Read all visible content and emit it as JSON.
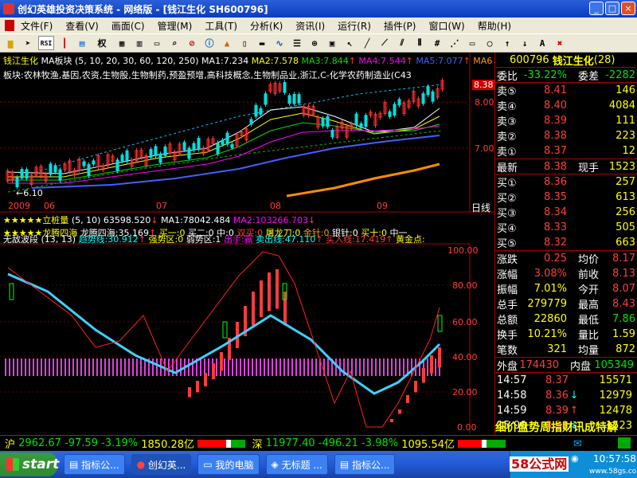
{
  "window": {
    "title": "创幻英雄投资决策系统 - 网络版 - [钱江生化 SH600796]"
  },
  "menu": [
    "文件(F)",
    "查看(V)",
    "画面(C)",
    "管理(M)",
    "工具(T)",
    "分析(K)",
    "资讯(I)",
    "运行(R)",
    "插件(P)",
    "窗口(W)",
    "帮助(H)"
  ],
  "toolbar": {
    "rsi": "RSI",
    "fn": "权"
  },
  "chart": {
    "main_header": {
      "name": "钱江生化",
      "ma_label": "MA板块",
      "ma_params": "(5, 10, 20, 30, 60, 120, 250)",
      "ma1": "MA1:7.234",
      "ma2": "MA2:7.578",
      "ma3": "MA3:7.844",
      "ma4": "MA4:7.544",
      "ma5": "MA5:7.077",
      "ma6": "MA6"
    },
    "sector_line": "板块:农林牧渔,基因,农资,生物股,生物制药,预盈预增,高科技概念,生物制品业,浙江,C-化学农药制造业(C43",
    "price_labels": [
      "8.38",
      "8.00",
      "7.00"
    ],
    "low_label": "6.10",
    "date_labels": [
      "2009",
      "06",
      "07",
      "08",
      "09"
    ],
    "period": "日线",
    "vol_header": {
      "stars": "★★★★★",
      "name": "立桩量",
      "params": "(5, 10)",
      "value": "63598.520",
      "ma1": "MA1:78042.484",
      "ma2": "MA2:103266.703"
    },
    "ind1": {
      "stars": "★★★★★",
      "name": "龙腾四海",
      "v1": "龙腾四海:35.169",
      "v2": "买一:0",
      "v3": "买二:0",
      "v4": "中:0",
      "v5": "双买:0",
      "v6": "屠龙刀:0",
      "v7": "金针:0",
      "v8": "银针:0",
      "v9": "买十:0",
      "v10": "中一"
    },
    "ind2": {
      "name": "无敌波段",
      "params": "(13, 13)",
      "v1": "趋势线:30.912",
      "v2": "强势区:0",
      "v3": "弱势区:1",
      "v4": "出手:赢",
      "v5": "卖出线:47.110",
      "v6": "买入线:17.419",
      "v7": "黄金点:"
    },
    "ind_scale": [
      "100.00",
      "80.00",
      "60.00",
      "40.00",
      "20.00",
      "0.00"
    ]
  },
  "quote": {
    "code": "600796",
    "name": "钱江生化",
    "count": "(28)",
    "weibi_label": "委比",
    "weibi_value": "-33.22%",
    "weicha_label": "委差",
    "weicha_value": "-2282",
    "sells": [
      {
        "label": "卖⑤",
        "price": "8.41",
        "vol": "146"
      },
      {
        "label": "卖④",
        "price": "8.40",
        "vol": "4084"
      },
      {
        "label": "卖③",
        "price": "8.39",
        "vol": "111"
      },
      {
        "label": "卖②",
        "price": "8.38",
        "vol": "223"
      },
      {
        "label": "卖①",
        "price": "8.37",
        "vol": "12"
      }
    ],
    "last_label": "最新",
    "last_value": "8.38",
    "hand_label": "现手",
    "hand_value": "1523",
    "buys": [
      {
        "label": "买①",
        "price": "8.36",
        "vol": "257"
      },
      {
        "label": "买②",
        "price": "8.35",
        "vol": "613"
      },
      {
        "label": "买③",
        "price": "8.34",
        "vol": "256"
      },
      {
        "label": "买④",
        "price": "8.33",
        "vol": "505"
      },
      {
        "label": "买⑤",
        "price": "8.32",
        "vol": "663"
      }
    ],
    "stats": [
      {
        "l1": "涨跌",
        "v1": "0.25",
        "l2": "均价",
        "v2": "8.17"
      },
      {
        "l1": "涨幅",
        "v1": "3.08%",
        "l2": "前收",
        "v2": "8.13"
      },
      {
        "l1": "振幅",
        "v1": "7.01%",
        "l2": "今开",
        "v2": "8.07"
      },
      {
        "l1": "总手",
        "v1": "279779",
        "l2": "最高",
        "v2": "8.43"
      },
      {
        "l1": "总额",
        "v1": "22860",
        "l2": "最低",
        "v2": "7.86"
      },
      {
        "l1": "换手",
        "v1": "10.21%",
        "l2": "量比",
        "v2": "1.59"
      },
      {
        "l1": "笔数",
        "v1": "321",
        "l2": "均量",
        "v2": "872"
      }
    ],
    "outer_label": "外盘",
    "outer_value": "174430",
    "inner_label": "内盘",
    "inner_value": "105349",
    "ticks": [
      {
        "time": "14:57",
        "price": "8.37",
        "arrow": "",
        "vol": "15571"
      },
      {
        "time": "14:58",
        "price": "8.36",
        "arrow": "↓",
        "vol": "12979"
      },
      {
        "time": "14:59",
        "price": "8.39",
        "arrow": "↑",
        "vol": "12478"
      },
      {
        "time": "15:00",
        "price": "8.38",
        "arrow": "↓",
        "vol": "1523"
      }
    ],
    "tabs": "细价盘势周指财讯成特解"
  },
  "status": {
    "sh_label": "沪",
    "sh_index": "2962.67",
    "sh_change": "-97.59",
    "sh_pct": "-3.19%",
    "sh_amount": "1850.28亿",
    "sz_label": "深",
    "sz_index": "11977.40",
    "sz_change": "-496.21",
    "sz_pct": "-3.98%",
    "sz_amount": "1095.54亿"
  },
  "taskbar": {
    "start": "start",
    "buttons": [
      "指标公...",
      "创幻英...",
      "我的电脑",
      "无标题 ...",
      "指标公..."
    ],
    "clock": "10:57:58",
    "watermark": "58公式网",
    "watermark_url": "www.58gs.com"
  }
}
